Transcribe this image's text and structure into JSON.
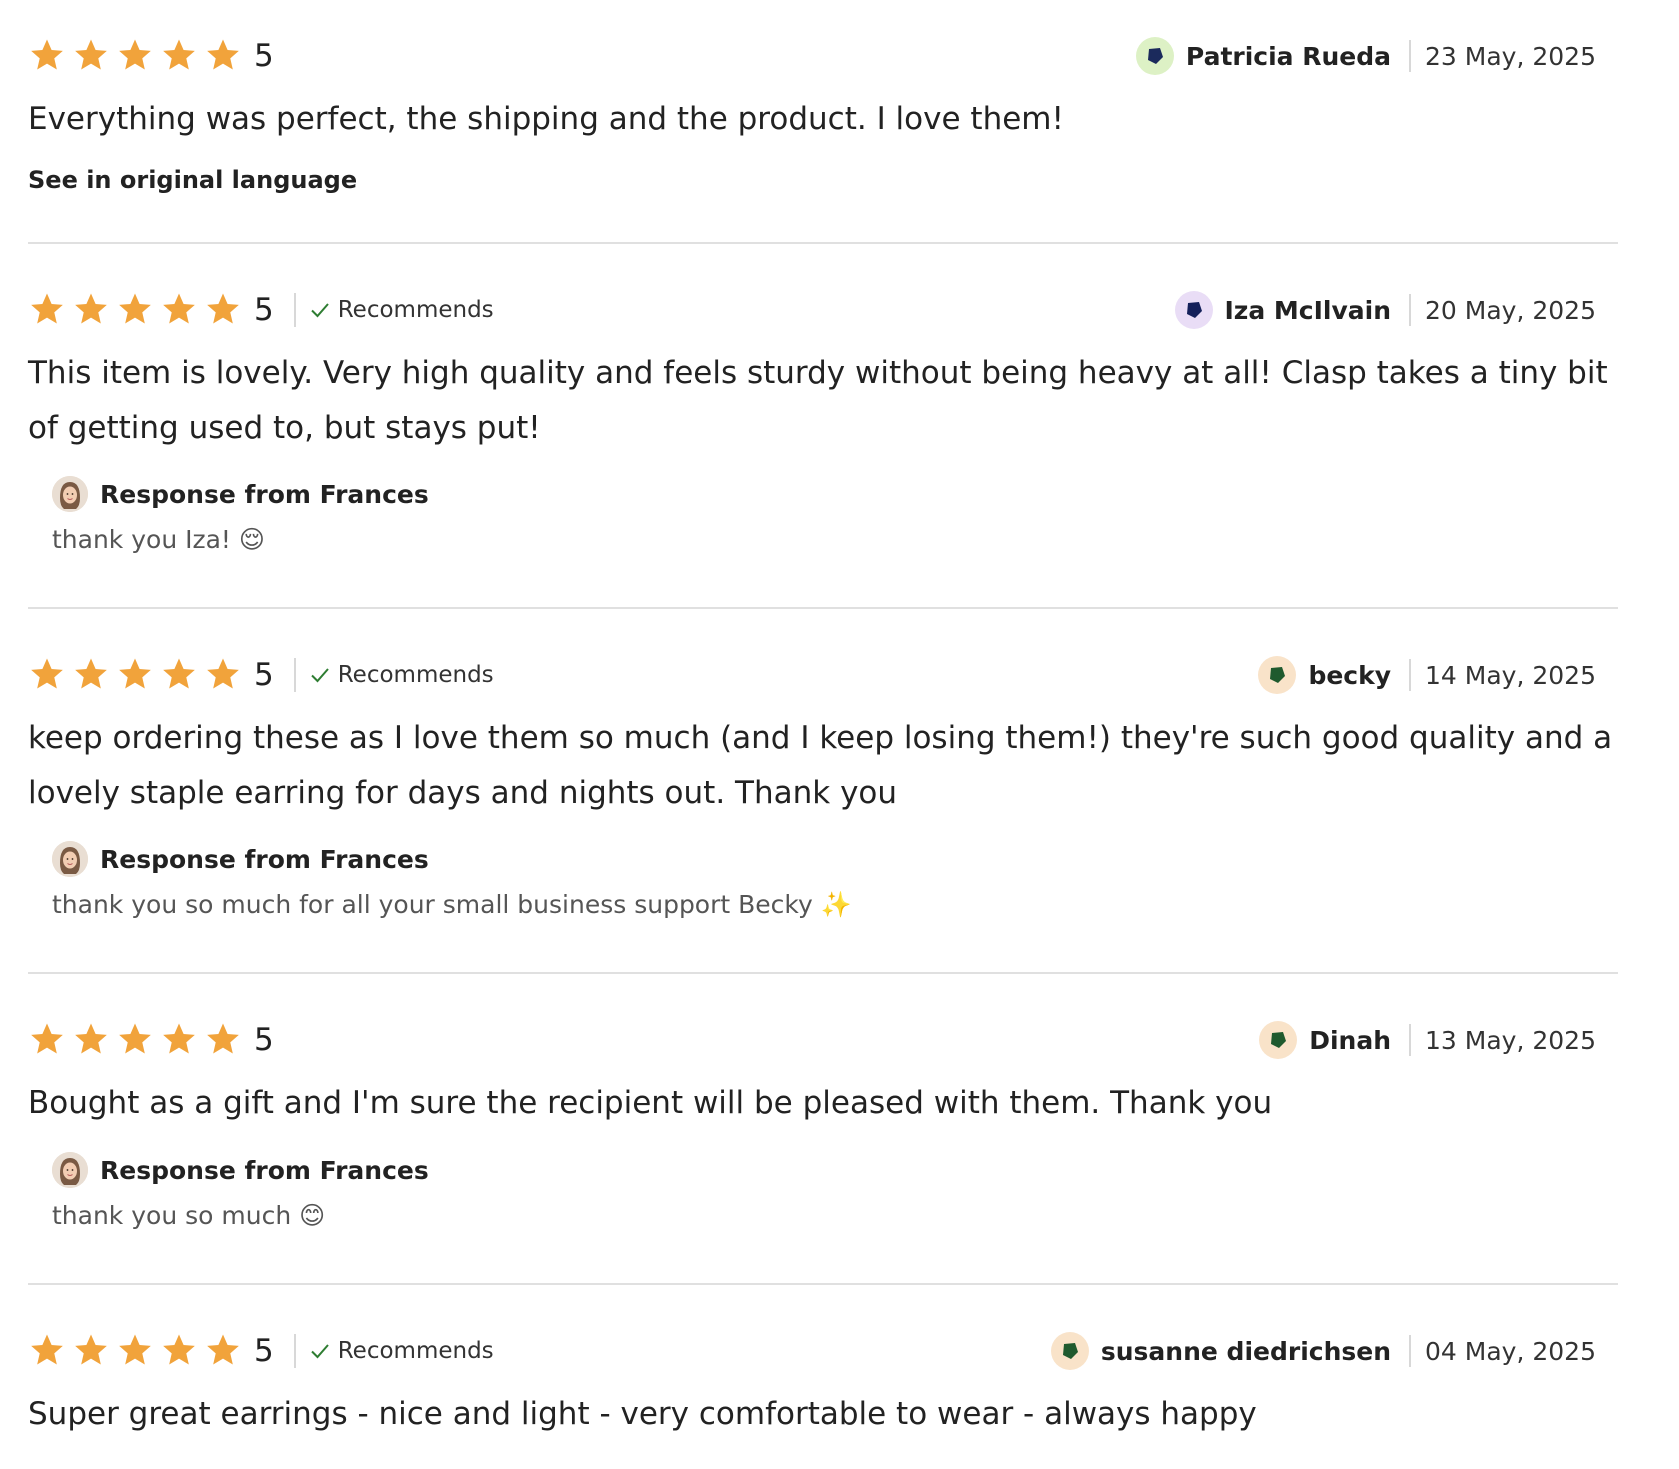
{
  "colors": {
    "star": "#F1A33B",
    "check": "#2E7D32",
    "divider": "#E0E0E0"
  },
  "icons": {
    "star": "star-icon",
    "check": "checkmark-icon",
    "avatar": "user-avatar-icon",
    "shop": "shop-owner-avatar"
  },
  "reviews": [
    {
      "rating": 5,
      "rating_label": "5",
      "recommends": false,
      "author": "Patricia Rueda",
      "date": "23 May, 2025",
      "text": "Everything was perfect, the shipping and the product. I love them!",
      "original_language_link": "See in original language",
      "avatar_colors": {
        "bg": "#DDF1C5",
        "fg": "#1B2A5C"
      },
      "response": null
    },
    {
      "rating": 5,
      "rating_label": "5",
      "recommends": true,
      "recommends_label": "Recommends",
      "author": "Iza McIlvain",
      "date": "20 May, 2025",
      "text": "This item is lovely. Very high quality and feels sturdy without being heavy at all! Clasp takes a tiny bit of getting used to, but stays put!",
      "avatar_colors": {
        "bg": "#E9DDF6",
        "fg": "#14205A"
      },
      "response": {
        "title": "Response from Frances",
        "text": "thank you Iza! 😌"
      }
    },
    {
      "rating": 5,
      "rating_label": "5",
      "recommends": true,
      "recommends_label": "Recommends",
      "author": "becky",
      "date": "14 May, 2025",
      "text": "keep ordering these as I love them so much (and I keep losing them!) they're such good quality and a lovely staple earring for days and nights out. Thank you",
      "avatar_colors": {
        "bg": "#F9E3C9",
        "fg": "#1F5A2E"
      },
      "response": {
        "title": "Response from Frances",
        "text": "thank you so much for all your small business support Becky ✨"
      }
    },
    {
      "rating": 5,
      "rating_label": "5",
      "recommends": false,
      "author": "Dinah",
      "date": "13 May, 2025",
      "text": "Bought as a gift and I'm sure the recipient will be pleased with them. Thank you",
      "avatar_colors": {
        "bg": "#F9E3C9",
        "fg": "#1F5A2E"
      },
      "response": {
        "title": "Response from Frances",
        "text": "thank you so much 😊"
      }
    },
    {
      "rating": 5,
      "rating_label": "5",
      "recommends": true,
      "recommends_label": "Recommends",
      "author": "susanne diedrichsen",
      "date": "04 May, 2025",
      "text": "Super great earrings - nice and light - very comfortable to wear - always happy",
      "avatar_colors": {
        "bg": "#F9E3C9",
        "fg": "#1F5A2E"
      },
      "response": null
    }
  ]
}
